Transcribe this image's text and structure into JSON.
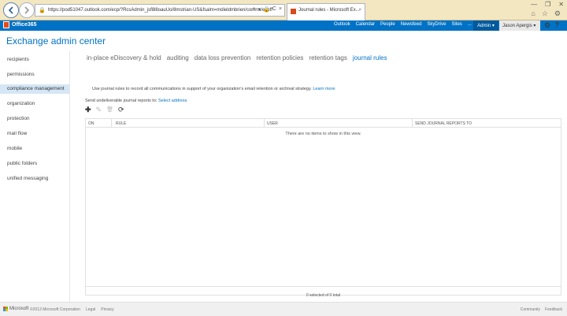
{
  "browser": {
    "url": "https://pod51047.outlook.com/ecp/?RcsAdmin_jsf8l8oauUo/8mstrian-US&fsalm=mdieldmbrien/comrm/ecoff",
    "tab_title": "Journal rules - Microsoft Ex...",
    "tab_close": "×",
    "lock_glyph": "🔒",
    "addr_icons": [
      "⌕",
      "▾",
      "🔒",
      "C",
      "×"
    ],
    "win_controls": [
      "—",
      "❐",
      "✕"
    ],
    "chrome_icons": [
      "⌂",
      "☆",
      "⚙"
    ]
  },
  "o365": {
    "logo_text": "Office365",
    "nav": [
      "Outlook",
      "Calendar",
      "People",
      "Newsfeed",
      "SkyDrive",
      "Sites",
      "..."
    ],
    "admin_label": "Admin ▾",
    "user_name": "Jason Apergis  ▾",
    "gear_glyph": "⚙",
    "help_glyph": "?"
  },
  "app": {
    "title": "Exchange admin center"
  },
  "sidebar": {
    "items": [
      {
        "label": "recipients",
        "active": false
      },
      {
        "label": "permissions",
        "active": false
      },
      {
        "label": "compliance management",
        "active": true
      },
      {
        "label": "organization",
        "active": false
      },
      {
        "label": "protection",
        "active": false
      },
      {
        "label": "mail flow",
        "active": false
      },
      {
        "label": "mobile",
        "active": false
      },
      {
        "label": "public folders",
        "active": false
      },
      {
        "label": "unified messaging",
        "active": false
      }
    ]
  },
  "tabs": [
    {
      "label": "in-place eDiscovery & hold",
      "active": false
    },
    {
      "label": "auditing",
      "active": false
    },
    {
      "label": "data loss prevention",
      "active": false
    },
    {
      "label": "retention policies",
      "active": false
    },
    {
      "label": "retention tags",
      "active": false
    },
    {
      "label": "journal rules",
      "active": true
    }
  ],
  "content": {
    "intro_text": "Use journal rules to record all communications in support of your organization's email retention or archival strategy.",
    "intro_link": "Learn more",
    "undeliv_text": "Send undeliverable journal reports to:",
    "undeliv_link": "Select address",
    "toolbar": {
      "add": "✚",
      "edit": "✎",
      "delete": "🗑",
      "refresh": "⟳"
    },
    "columns": [
      "ON",
      "RULE",
      "USER",
      "SEND JOURNAL REPORTS TO"
    ],
    "empty_message": "There are no items to show in this view.",
    "count_text": "0 selected of 0 total"
  },
  "footer": {
    "ms_label": "Microsoft",
    "left_links": [
      "©2013 Microsoft Corporation",
      "Legal",
      "Privacy"
    ],
    "right_links": [
      "Community",
      "Feedback"
    ]
  },
  "colors": {
    "accent": "#0072c6",
    "o365_bar": "#0072c6",
    "browser_bar": "#f3e7c2",
    "sidebar_active": "#d5e7f6"
  }
}
